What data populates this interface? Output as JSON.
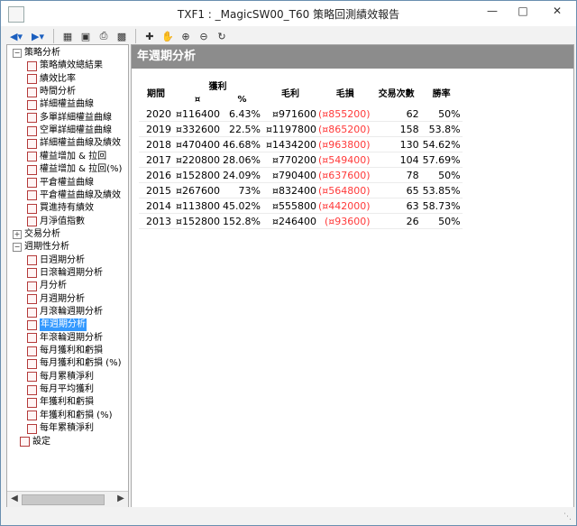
{
  "window": {
    "title": "TXF1 : _MagicSW00_T60 策略回測績效報告"
  },
  "tree": {
    "nodes": [
      {
        "label": "策略分析",
        "level": 0,
        "expander": "−",
        "icon": false
      },
      {
        "label": "策略績效總結果",
        "level": 2,
        "icon": true
      },
      {
        "label": "績效比率",
        "level": 2,
        "icon": true
      },
      {
        "label": "時間分析",
        "level": 2,
        "icon": true
      },
      {
        "label": "詳細權益曲線",
        "level": 2,
        "icon": true
      },
      {
        "label": "多單詳細權益曲線",
        "level": 2,
        "icon": true
      },
      {
        "label": "空單詳細權益曲線",
        "level": 2,
        "icon": true
      },
      {
        "label": "詳細權益曲線及績效",
        "level": 2,
        "icon": true
      },
      {
        "label": "權益增加 & 拉回",
        "level": 2,
        "icon": true
      },
      {
        "label": "權益增加 & 拉回(%)",
        "level": 2,
        "icon": true
      },
      {
        "label": "平倉權益曲線",
        "level": 2,
        "icon": true
      },
      {
        "label": "平倉權益曲線及績效",
        "level": 2,
        "icon": true
      },
      {
        "label": "買進持有績效",
        "level": 2,
        "icon": true
      },
      {
        "label": "月淨值指數",
        "level": 2,
        "icon": true
      },
      {
        "label": "交易分析",
        "level": 0,
        "expander": "+",
        "icon": false
      },
      {
        "label": "週期性分析",
        "level": 0,
        "expander": "−",
        "icon": false
      },
      {
        "label": "日週期分析",
        "level": 2,
        "icon": true
      },
      {
        "label": "日滾輪週期分析",
        "level": 2,
        "icon": true
      },
      {
        "label": "月分析",
        "level": 2,
        "icon": true
      },
      {
        "label": "月週期分析",
        "level": 2,
        "icon": true
      },
      {
        "label": "月滾輪週期分析",
        "level": 2,
        "icon": true
      },
      {
        "label": "年週期分析",
        "level": 2,
        "icon": true,
        "selected": true
      },
      {
        "label": "年滾輪週期分析",
        "level": 2,
        "icon": true
      },
      {
        "label": "每月獲利和虧損",
        "level": 2,
        "icon": true
      },
      {
        "label": "每月獲利和虧損 (%)",
        "level": 2,
        "icon": true
      },
      {
        "label": "每月累積淨利",
        "level": 2,
        "icon": true
      },
      {
        "label": "每月平均獲利",
        "level": 2,
        "icon": true
      },
      {
        "label": "年獲利和虧損",
        "level": 2,
        "icon": true
      },
      {
        "label": "年獲利和虧損 (%)",
        "level": 2,
        "icon": true
      },
      {
        "label": "每年累積淨利",
        "level": 2,
        "icon": true
      },
      {
        "label": "設定",
        "level": 1,
        "icon": true
      }
    ]
  },
  "report": {
    "title": "年週期分析",
    "headers": {
      "period": "期間",
      "net_profit": "獲利",
      "net_profit_sub": "¤",
      "pct_sub": "%",
      "gross_profit": "毛利",
      "gross_loss": "毛損",
      "trades": "交易次數",
      "win_rate": "勝率"
    },
    "rows": [
      {
        "year": "2020",
        "net": "¤116400",
        "pct": "6.43%",
        "gross_profit": "¤971600",
        "gross_loss": "(¤855200)",
        "trades": "62",
        "win_rate": "50%"
      },
      {
        "year": "2019",
        "net": "¤332600",
        "pct": "22.5%",
        "gross_profit": "¤1197800",
        "gross_loss": "(¤865200)",
        "trades": "158",
        "win_rate": "53.8%"
      },
      {
        "year": "2018",
        "net": "¤470400",
        "pct": "46.68%",
        "gross_profit": "¤1434200",
        "gross_loss": "(¤963800)",
        "trades": "130",
        "win_rate": "54.62%"
      },
      {
        "year": "2017",
        "net": "¤220800",
        "pct": "28.06%",
        "gross_profit": "¤770200",
        "gross_loss": "(¤549400)",
        "trades": "104",
        "win_rate": "57.69%"
      },
      {
        "year": "2016",
        "net": "¤152800",
        "pct": "24.09%",
        "gross_profit": "¤790400",
        "gross_loss": "(¤637600)",
        "trades": "78",
        "win_rate": "50%"
      },
      {
        "year": "2015",
        "net": "¤267600",
        "pct": "73%",
        "gross_profit": "¤832400",
        "gross_loss": "(¤564800)",
        "trades": "65",
        "win_rate": "53.85%"
      },
      {
        "year": "2014",
        "net": "¤113800",
        "pct": "45.02%",
        "gross_profit": "¤555800",
        "gross_loss": "(¤442000)",
        "trades": "63",
        "win_rate": "58.73%"
      },
      {
        "year": "2013",
        "net": "¤152800",
        "pct": "152.8%",
        "gross_profit": "¤246400",
        "gross_loss": "(¤93600)",
        "trades": "26",
        "win_rate": "50%"
      }
    ]
  },
  "colors": {
    "loss": "#ff3a3a",
    "selection": "#3399ff",
    "header_bar": "#8c8c8c"
  }
}
